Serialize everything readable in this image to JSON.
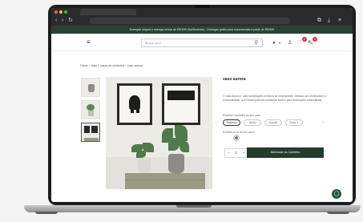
{
  "browser": {
    "nav_icons": [
      "back-icon",
      "forward-icon",
      "reload-icon"
    ],
    "toolbar_icons": [
      "extensions-icon",
      "menu-icon"
    ]
  },
  "promo_bar": {
    "text": "Entregas segura e entrega acima de R$ 299 (Sul/Sudeste) - Entregas grátis para encomendas a partir de R$ 599",
    "bg_color": "#274334"
  },
  "header": {
    "search_placeholder": "Buscar itens",
    "cart_count": "0",
    "wishlist_count": "0"
  },
  "breadcrumb": "Home > Sala > vasos de cerâmica > vaso aurora",
  "product": {
    "title": "vaso aurora",
    "description": "O vaso Aurora é uma homenagem à beleza da simplicidade. Destaca seu minimalismo e funcionalidade, que trazem para seu ambiente sereno para decorações minimalistas.",
    "size_label": "Escolha o tamanho do seu vaso:",
    "sizes": [
      "Pequeno",
      "Médio",
      "Grande",
      "Extra G"
    ],
    "selected_size_index": 0,
    "color_label": "Escolha a cor do seu vaso:",
    "selected_color": "#7b7f6f",
    "quantity": "1",
    "minus_label": "−",
    "plus_label": "+",
    "add_to_cart_label": "Adicionar ao Carrinho",
    "button_color": "#243b2e"
  }
}
